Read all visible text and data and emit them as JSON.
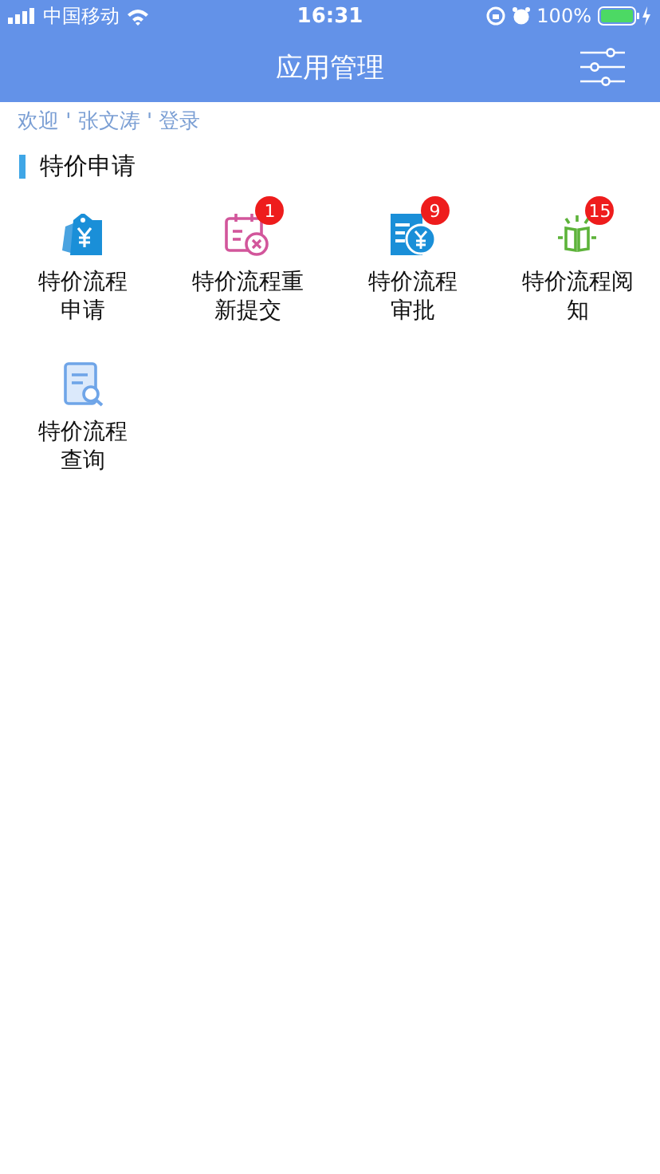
{
  "status_bar": {
    "carrier": "中国移动",
    "time": "16:31",
    "battery": "100%"
  },
  "nav_bar": {
    "title": "应用管理"
  },
  "welcome": "欢迎 ' 张文涛 ' 登录",
  "section": {
    "title": "特价申请",
    "items": [
      {
        "lines": [
          "特价流程",
          "申请"
        ]
      },
      {
        "lines": [
          "特价流程重",
          "新提交"
        ],
        "badge": "1"
      },
      {
        "lines": [
          "特价流程",
          "审批"
        ],
        "badge": "9"
      },
      {
        "lines": [
          "特价流程阅",
          "知"
        ],
        "badge": "15"
      },
      {
        "lines": [
          "特价流程",
          "查询"
        ]
      }
    ]
  }
}
